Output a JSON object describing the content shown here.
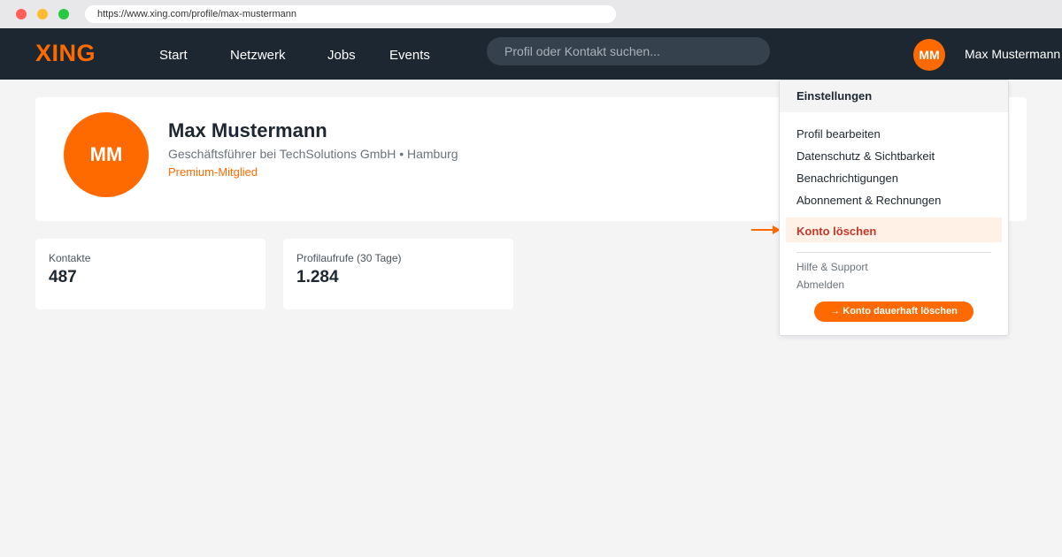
{
  "browser": {
    "url": "https://www.xing.com/profile/max-mustermann"
  },
  "navbar": {
    "logo": "XING",
    "items": [
      {
        "label": "Start"
      },
      {
        "label": "Netzwerk"
      },
      {
        "label": "Jobs"
      },
      {
        "label": "Events"
      }
    ],
    "search_placeholder": "Profil oder Kontakt suchen...",
    "avatar_initials": "MM",
    "username": "Max Mustermann"
  },
  "profile": {
    "initials": "MM",
    "name": "Max Mustermann",
    "headline": "Geschäftsführer bei TechSolutions GmbH • Hamburg",
    "membership": "Premium-Mitglied"
  },
  "stats": [
    {
      "label": "Kontakte",
      "value": "487"
    },
    {
      "label": "Profilaufrufe (30 Tage)",
      "value": "1.284"
    }
  ],
  "dropdown": {
    "header": "Einstellungen",
    "items": [
      {
        "label": "Profil bearbeiten"
      },
      {
        "label": "Datenschutz & Sichtbarkeit"
      },
      {
        "label": "Benachrichtigungen"
      },
      {
        "label": "Abonnement & Rechnungen"
      }
    ],
    "danger_item": "Konto löschen",
    "secondary_items": [
      {
        "label": "Hilfe & Support"
      },
      {
        "label": "Abmelden"
      }
    ],
    "cta": "→ Konto dauerhaft löschen"
  },
  "colors": {
    "brand": "#ff6a00",
    "navbar_bg": "#1d2731",
    "danger_text": "#c0392b",
    "danger_highlight": "#fff1e6"
  },
  "icons": {
    "pointer": "arrow-right-icon"
  }
}
